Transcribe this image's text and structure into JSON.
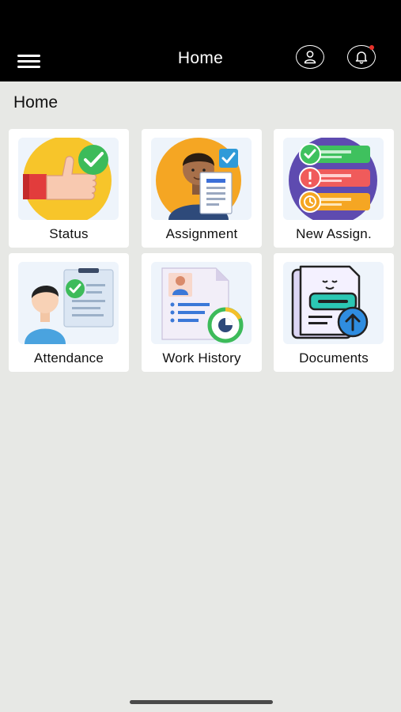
{
  "header": {
    "title": "Home",
    "menu_icon": "hamburger-icon",
    "profile_icon": "user-icon",
    "notification_icon": "bell-icon",
    "notification_dot_color": "#e8322b"
  },
  "page": {
    "heading": "Home"
  },
  "tiles": [
    {
      "label": "Status",
      "icon": "thumbs-up-check-icon"
    },
    {
      "label": "Assignment",
      "icon": "person-document-icon"
    },
    {
      "label": "New Assign.",
      "icon": "task-list-icon"
    },
    {
      "label": "Attendance",
      "icon": "attendance-check-icon"
    },
    {
      "label": "Work History",
      "icon": "history-document-icon"
    },
    {
      "label": "Documents",
      "icon": "document-upload-icon"
    }
  ]
}
